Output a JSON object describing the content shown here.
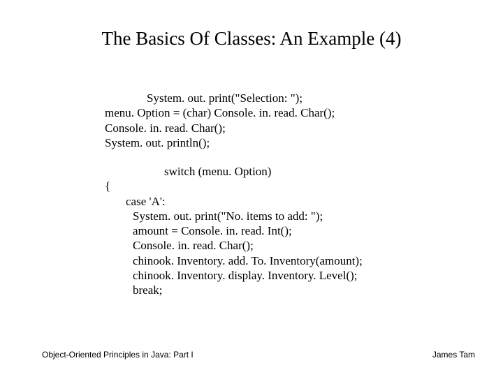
{
  "title": "The Basics Of Classes: An Example (4)",
  "code1": {
    "l1": "System. out. print(\"Selection: \");",
    "l2": "menu. Option = (char) Console. in. read. Char();",
    "l3": "Console. in. read. Char();",
    "l4": "System. out. println();"
  },
  "code2": {
    "switch": "switch (menu. Option)",
    "brace": "{",
    "c1": "case 'A':",
    "c2": "System. out. print(\"No. items to add: \");",
    "c3": "amount = Console. in. read. Int();",
    "c4": "Console. in. read. Char();",
    "c5": "chinook. Inventory. add. To. Inventory(amount);",
    "c6": "chinook. Inventory. display. Inventory. Level();",
    "c7": "break;"
  },
  "footer": {
    "left": "Object-Oriented Principles in Java: Part I",
    "right": "James Tam"
  }
}
